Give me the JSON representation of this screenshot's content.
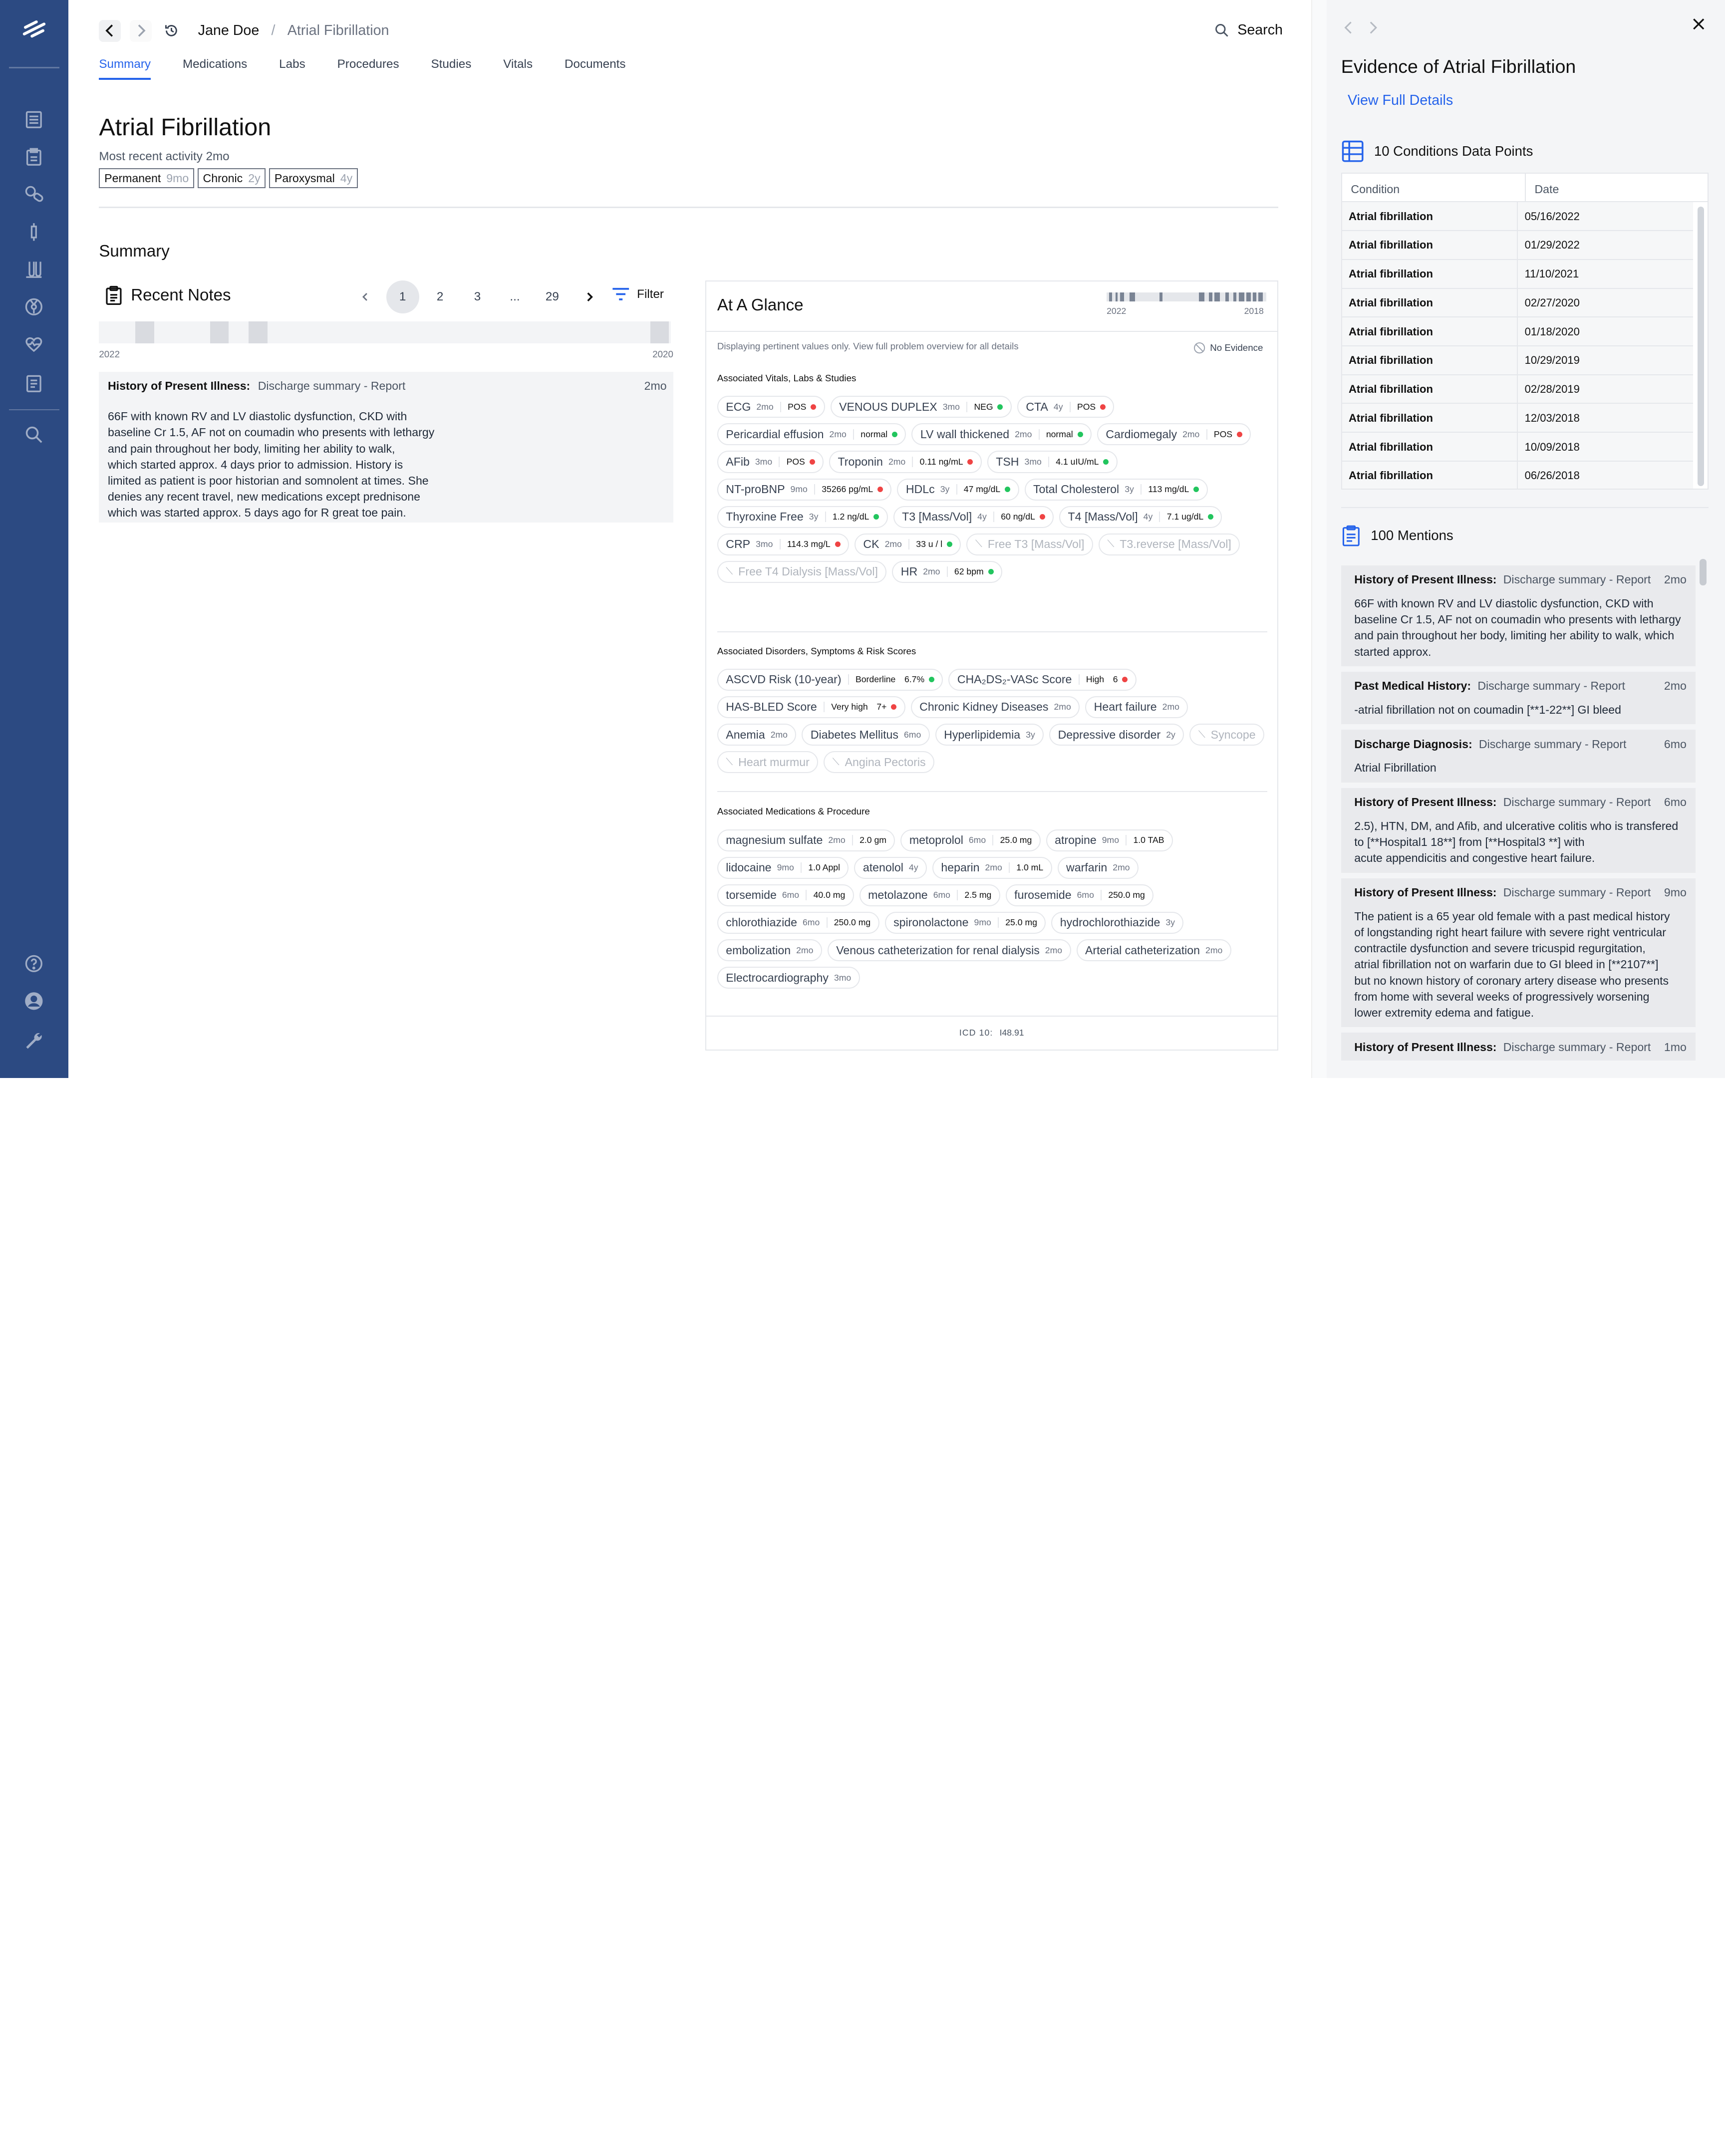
{
  "breadcrumb": {
    "patient": "Jane Doe",
    "separator": "/",
    "current": "Atrial Fibrillation"
  },
  "search": {
    "label": "Search"
  },
  "tabs": [
    "Summary",
    "Medications",
    "Labs",
    "Procedures",
    "Studies",
    "Vitals",
    "Documents"
  ],
  "condition": {
    "title": "Atrial Fibrillation",
    "recent": "Most recent activity 2mo",
    "chips": [
      {
        "label": "Permanent",
        "age": "9mo"
      },
      {
        "label": "Chronic",
        "age": "2y"
      },
      {
        "label": "Paroxysmal",
        "age": "4y"
      }
    ]
  },
  "summary": {
    "heading": "Summary"
  },
  "notes": {
    "title": "Recent Notes",
    "pages": [
      "1",
      "2",
      "3",
      "...",
      "29"
    ],
    "filter": "Filter",
    "timeline_start": "2022",
    "timeline_end": "2020",
    "note": {
      "label": "History of Present Illness:",
      "type": "Discharge summary - Report",
      "age": "2mo",
      "body": "66F with known RV and LV diastolic dysfunction, CKD with\nbaseline Cr 1.5, AF not on coumadin who presents with lethargy\nand pain throughout her body, limiting her ability to walk,\nwhich started approx. 4 days prior to admission. History is\nlimited as patient is poor historian and somnolent at times. She\ndenies any recent travel, new medications except prednisone\nwhich was started approx. 5 days ago for R great toe pain."
    }
  },
  "glance": {
    "title": "At A Glance",
    "year_start": "2022",
    "year_end": "2018",
    "note": "Displaying pertinent values only. View full problem overview for all details",
    "no_evidence": "No Evidence",
    "sections": {
      "vitals": "Associated Vitals, Labs & Studies",
      "disorders": "Associated Disorders, Symptoms & Risk Scores",
      "meds": "Associated Medications & Procedure"
    },
    "vitals": [
      {
        "name": "ECG",
        "age": "2mo",
        "value": "POS",
        "status": "r"
      },
      {
        "name": "VENOUS DUPLEX",
        "age": "3mo",
        "value": "NEG",
        "status": "g"
      },
      {
        "name": "CTA",
        "age": "4y",
        "value": "POS",
        "status": "r"
      },
      {
        "name": "Pericardial effusion",
        "age": "2mo",
        "value": "normal",
        "status": "g"
      },
      {
        "name": "LV wall thickened",
        "age": "2mo",
        "value": "normal",
        "status": "g"
      },
      {
        "name": "Cardiomegaly",
        "age": "2mo",
        "value": "POS",
        "status": "r"
      },
      {
        "name": "AFib",
        "age": "3mo",
        "value": "POS",
        "status": "r"
      },
      {
        "name": "Troponin",
        "age": "2mo",
        "value": "0.11 ng/mL",
        "status": "r"
      },
      {
        "name": "TSH",
        "age": "3mo",
        "value": "4.1 uIU/mL",
        "status": "g"
      },
      {
        "name": "NT-proBNP",
        "age": "9mo",
        "value": "35266 pg/mL",
        "status": "r"
      },
      {
        "name": "HDLc",
        "age": "3y",
        "value": "47 mg/dL",
        "status": "g"
      },
      {
        "name": "Total Cholesterol",
        "age": "3y",
        "value": "113 mg/dL",
        "status": "g"
      },
      {
        "name": "Thyroxine Free",
        "age": "3y",
        "value": "1.2 ng/dL",
        "status": "g"
      },
      {
        "name": "T3 [Mass/Vol]",
        "age": "4y",
        "value": "60 ng/dL",
        "status": "r"
      },
      {
        "name": "T4 [Mass/Vol]",
        "age": "4y",
        "value": "7.1 ug/dL",
        "status": "g"
      },
      {
        "name": "CRP",
        "age": "3mo",
        "value": "114.3 mg/L",
        "status": "r"
      },
      {
        "name": "CK",
        "age": "2mo",
        "value": "33 u / l",
        "status": "g"
      },
      {
        "name": "Free T3 [Mass/Vol]",
        "dim": true
      },
      {
        "name": "T3.reverse [Mass/Vol]",
        "dim": true
      },
      {
        "name": "Free T4 Dialysis [Mass/Vol]",
        "dim": true
      },
      {
        "name": "HR",
        "age": "2mo",
        "value": "62 bpm",
        "status": "g"
      }
    ],
    "disorders": [
      {
        "name": "ASCVD Risk (10-year)",
        "value": "Borderline",
        "value2": "6.7%",
        "status": "g"
      },
      {
        "name": "CHA₂DS₂-VASc Score",
        "value": "High",
        "value2": "6",
        "status": "r"
      },
      {
        "name": "HAS-BLED Score",
        "value": "Very high",
        "value2": "7+",
        "status": "r"
      },
      {
        "name": "Chronic Kidney Diseases",
        "age": "2mo"
      },
      {
        "name": "Heart failure",
        "age": "2mo"
      },
      {
        "name": "Anemia",
        "age": "2mo"
      },
      {
        "name": "Diabetes Mellitus",
        "age": "6mo"
      },
      {
        "name": "Hyperlipidemia",
        "age": "3y"
      },
      {
        "name": "Depressive disorder",
        "age": "2y"
      },
      {
        "name": "Syncope",
        "dim": true
      },
      {
        "name": "Heart murmur",
        "dim": true
      },
      {
        "name": "Angina Pectoris",
        "dim": true
      }
    ],
    "meds": [
      {
        "name": "magnesium sulfate",
        "age": "2mo",
        "value": "2.0 gm"
      },
      {
        "name": "metoprolol",
        "age": "6mo",
        "value": "25.0 mg"
      },
      {
        "name": "atropine",
        "age": "9mo",
        "value": "1.0 TAB"
      },
      {
        "name": "lidocaine",
        "age": "9mo",
        "value": "1.0 Appl"
      },
      {
        "name": "atenolol",
        "age": "4y"
      },
      {
        "name": "heparin",
        "age": "2mo",
        "value": "1.0 mL"
      },
      {
        "name": "warfarin",
        "age": "2mo"
      },
      {
        "name": "torsemide",
        "age": "6mo",
        "value": "40.0 mg"
      },
      {
        "name": "metolazone",
        "age": "6mo",
        "value": "2.5 mg"
      },
      {
        "name": "furosemide",
        "age": "6mo",
        "value": "250.0 mg"
      },
      {
        "name": "chlorothiazide",
        "age": "6mo",
        "value": "250.0 mg"
      },
      {
        "name": "spironolactone",
        "age": "9mo",
        "value": "25.0 mg"
      },
      {
        "name": "hydrochlorothiazide",
        "age": "3y"
      },
      {
        "name": "embolization",
        "age": "2mo"
      },
      {
        "name": "Venous catheterization for renal dialysis",
        "age": "2mo"
      },
      {
        "name": "Arterial catheterization",
        "age": "2mo"
      },
      {
        "name": "Electrocardiography",
        "age": "3mo"
      }
    ],
    "icd_label": "ICD 10:",
    "icd_code": "I48.91"
  },
  "evidence": {
    "title": "Evidence of Atrial Fibrillation",
    "link": "View Full Details",
    "data_points_title": "10 Conditions Data Points",
    "columns": [
      "Condition",
      "Date"
    ],
    "rows": [
      [
        "Atrial fibrillation",
        "05/16/2022"
      ],
      [
        "Atrial fibrillation",
        "01/29/2022"
      ],
      [
        "Atrial fibrillation",
        "11/10/2021"
      ],
      [
        "Atrial fibrillation",
        "02/27/2020"
      ],
      [
        "Atrial fibrillation",
        "01/18/2020"
      ],
      [
        "Atrial fibrillation",
        "10/29/2019"
      ],
      [
        "Atrial fibrillation",
        "02/28/2019"
      ],
      [
        "Atrial fibrillation",
        "12/03/2018"
      ],
      [
        "Atrial fibrillation",
        "10/09/2018"
      ],
      [
        "Atrial fibrillation",
        "06/26/2018"
      ]
    ],
    "mentions_title": "100 Mentions",
    "mentions": [
      {
        "label": "History of Present Illness:",
        "type": "Discharge summary - Report",
        "age": "2mo",
        "body": "66F with known RV and LV diastolic dysfunction, CKD with\nbaseline Cr 1.5, AF not on coumadin who presents with lethargy\nand pain throughout her body, limiting her ability to walk, which\nstarted approx."
      },
      {
        "label": "Past Medical History:",
        "type": "Discharge summary - Report",
        "age": "2mo",
        "body": "-atrial fibrillation not on coumadin [**1-22**] GI bleed"
      },
      {
        "label": "Discharge Diagnosis:",
        "type": "Discharge summary - Report",
        "age": "6mo",
        "body": "Atrial Fibrillation"
      },
      {
        "label": "History of Present Illness:",
        "type": "Discharge summary - Report",
        "age": "6mo",
        "body": "2.5), HTN, DM, and Afib, and ulcerative colitis who is transfered\nto [**Hospital1 18**] from [**Hospital3 **] with\nacute appendicitis and congestive heart failure."
      },
      {
        "label": "History of Present Illness:",
        "type": "Discharge summary - Report",
        "age": "9mo",
        "body": "The patient is a 65 year old female with a past medical history\nof longstanding right heart failure with severe right ventricular\ncontractile dysfunction and severe tricuspid regurgitation,\natrial fibrillation not on warfarin due to GI bleed in [**2107**]\nbut no known history of coronary artery disease who presents\nfrom home with several weeks of progressively worsening\nlower extremity edema and fatigue."
      },
      {
        "label": "History of Present Illness:",
        "type": "Discharge summary - Report",
        "age": "1mo",
        "body": ""
      }
    ]
  },
  "colors": {
    "sidebar": "#2c4a82",
    "accent": "#2563eb",
    "positive": "#ef4444",
    "normal": "#22c55e"
  }
}
